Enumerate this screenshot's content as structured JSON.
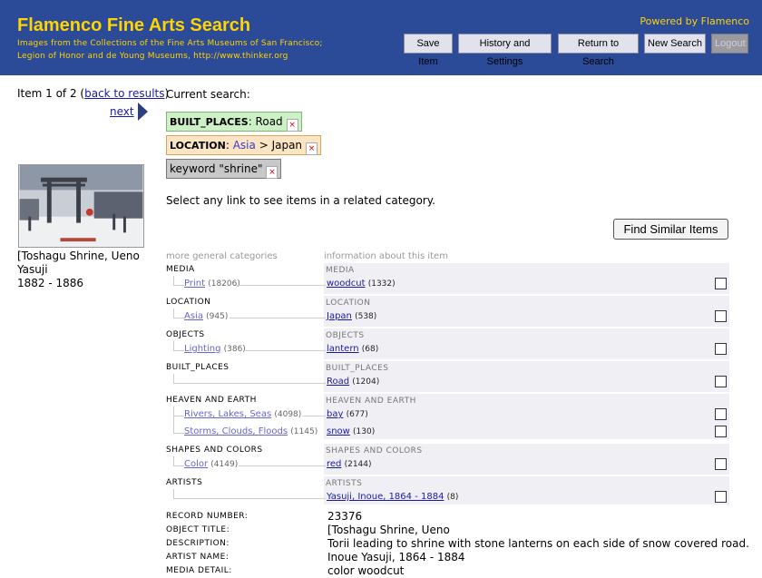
{
  "header": {
    "title": "Flamenco Fine Arts Search",
    "subtitle_line1": "Images from the Collections of the Fine Arts Museums of San Francisco;",
    "subtitle_line2": "Legion of Honor and de Young Museums, http://www.thinker.org",
    "powered_by": "Powered by Flamenco",
    "buttons": {
      "save_item": "Save Item",
      "history_settings": "History and Settings",
      "return_to_search": "Return to Search",
      "new_search": "New Search",
      "logout": "Logout"
    }
  },
  "colors": {
    "header_bg": "#2b4a97",
    "title_yellow": "#ffd400",
    "link_blue": "#1a1aa8"
  },
  "left": {
    "item_prefix": "Item 1 of 2 (",
    "back_link": "back to results",
    "item_suffix": ")",
    "next_link": "next",
    "object_title": "[Toshagu Shrine, Ueno Yasuji",
    "object_dates": "1882 - 1886"
  },
  "search": {
    "current_label": "Current search:",
    "built_places": {
      "facet": "BUILT_PLACES",
      "value": ": Road",
      "remove": "×"
    },
    "location": {
      "facet": "LOCATION",
      "sep": ": ",
      "parent": "Asia",
      "arrow": " > ",
      "value": "Japan",
      "remove": "×"
    },
    "keyword": {
      "text": "keyword \"shrine\"",
      "remove": "×"
    },
    "hint": "Select any link to see items in a related category.",
    "find_similar": "Find Similar Items"
  },
  "columns": {
    "general": "more general categories",
    "info": "information about this item"
  },
  "categories": [
    {
      "name": "MEDIA",
      "general": [
        {
          "label": "Print",
          "count": "(18206)"
        }
      ],
      "info": [
        {
          "label": "woodcut",
          "count": "(1332)"
        }
      ]
    },
    {
      "name": "LOCATION",
      "general": [
        {
          "label": "Asia",
          "count": "(945)"
        }
      ],
      "info": [
        {
          "label": "Japan",
          "count": "(538)"
        }
      ]
    },
    {
      "name": "OBJECTS",
      "general": [
        {
          "label": "Lighting",
          "count": "(386)"
        }
      ],
      "info": [
        {
          "label": "lantern",
          "count": "(68)"
        }
      ]
    },
    {
      "name": "BUILT_PLACES",
      "general": [],
      "info": [
        {
          "label": "Road",
          "count": "(1204)"
        }
      ]
    },
    {
      "name": "HEAVEN AND EARTH",
      "general": [
        {
          "label": "Rivers, Lakes, Seas",
          "count": "(4098)"
        },
        {
          "label": "Storms, Clouds, Floods",
          "count": "(1145)"
        }
      ],
      "info": [
        {
          "label": "bay",
          "count": "(677)"
        },
        {
          "label": "snow",
          "count": "(130)"
        }
      ]
    },
    {
      "name": "SHAPES AND COLORS",
      "general": [
        {
          "label": "Color",
          "count": "(4149)"
        }
      ],
      "info": [
        {
          "label": "red",
          "count": "(2144)"
        }
      ]
    },
    {
      "name": "ARTISTS",
      "general": [],
      "info": [
        {
          "label": "Yasuji, Inoue, 1864 - 1884",
          "count": "(8)"
        }
      ]
    }
  ],
  "metadata": [
    {
      "label": "RECORD NUMBER:",
      "value": "23376"
    },
    {
      "label": "OBJECT TITLE:",
      "value": "[Toshagu Shrine, Ueno"
    },
    {
      "label": "DESCRIPTION:",
      "value": "Torii leading to shrine with stone lanterns on each side of snow covered road."
    },
    {
      "label": "ARTIST NAME:",
      "value": "Inoue Yasuji, 1864 - 1884"
    },
    {
      "label": "MEDIA DETAIL:",
      "value": "color woodcut"
    }
  ]
}
